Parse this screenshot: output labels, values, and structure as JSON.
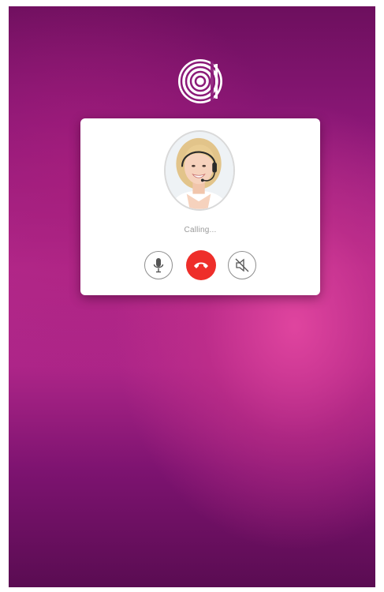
{
  "call": {
    "status_text": "Calling...",
    "buttons": {
      "mute": {
        "icon": "microphone-icon"
      },
      "end_call": {
        "icon": "phone-hangup-icon",
        "color": "#ee2e2a"
      },
      "speaker": {
        "icon": "speaker-muted-icon"
      }
    },
    "caller_avatar": {
      "icon": "caller-avatar-headset"
    }
  },
  "app": {
    "logo_icon": "concentric-circles-logo-icon"
  },
  "colors": {
    "background_top": "#6d0f5e",
    "background_mid": "#b42a8c",
    "accent_red": "#ee2e2a",
    "card": "#ffffff",
    "status_text": "#9a9a9a"
  }
}
